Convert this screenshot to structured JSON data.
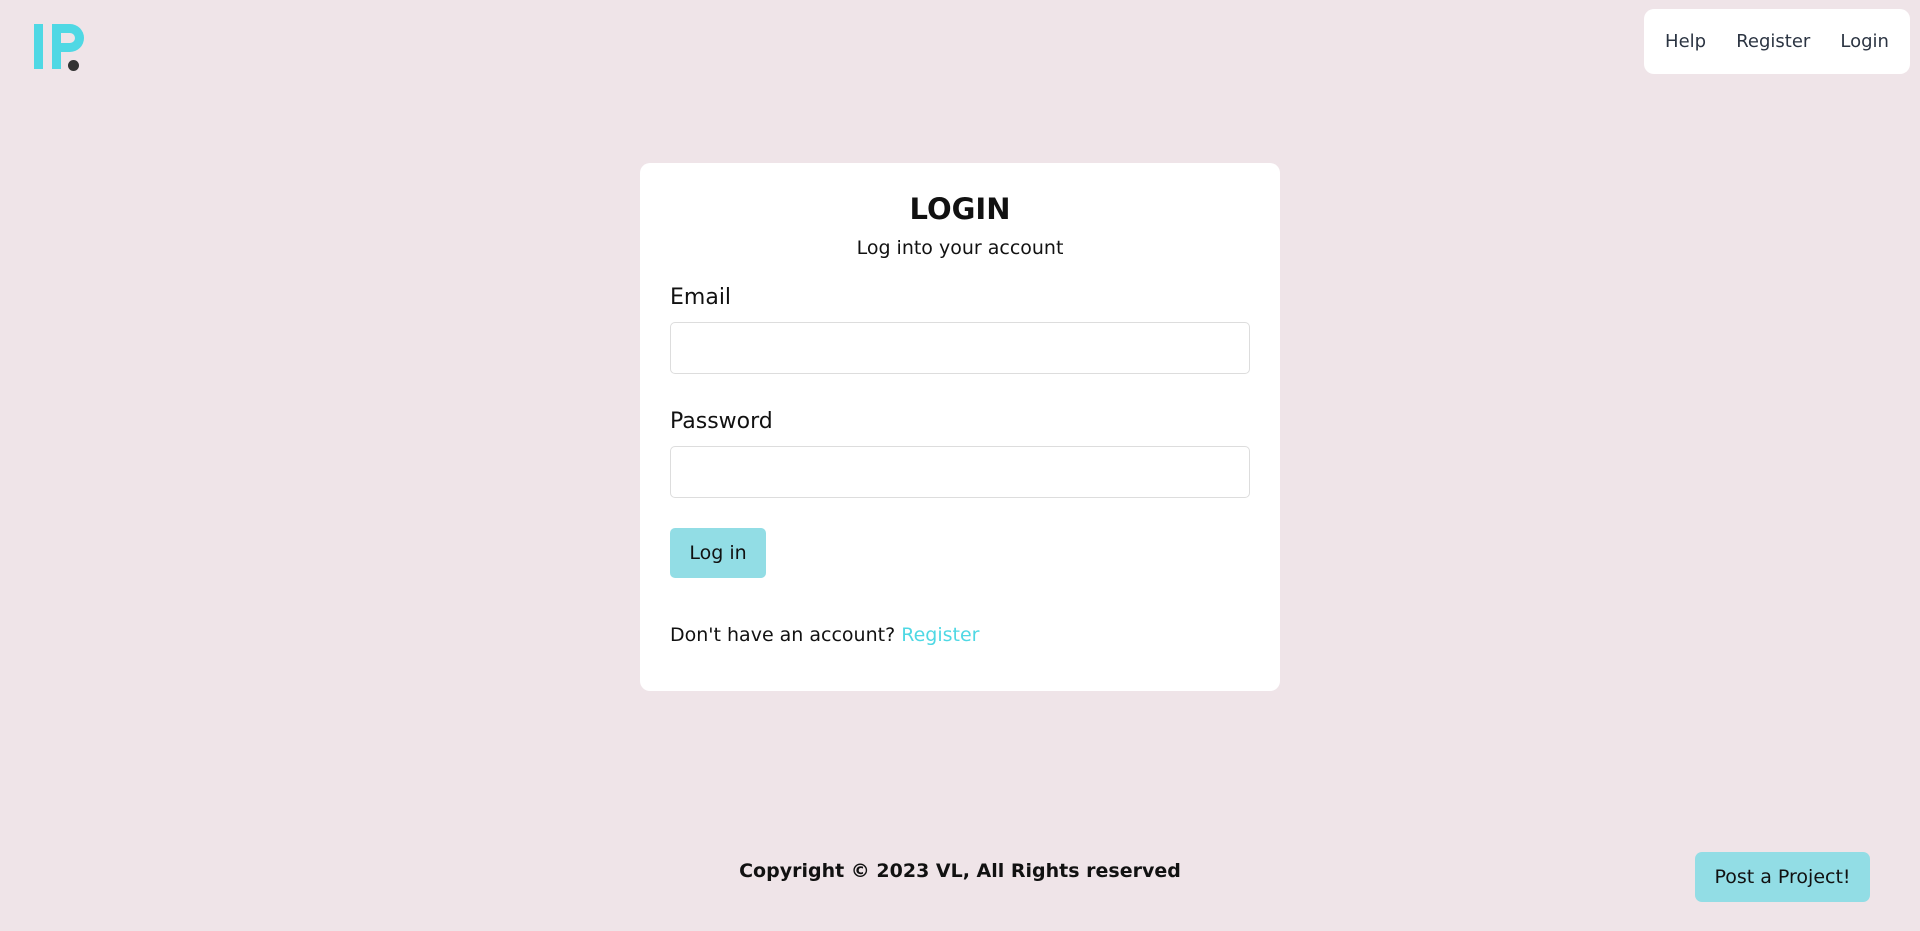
{
  "nav": {
    "help": "Help",
    "register": "Register",
    "login": "Login"
  },
  "login": {
    "title": "LOGIN",
    "subtitle": "Log into your account",
    "email_label": "Email",
    "email_value": "",
    "password_label": "Password",
    "password_value": "",
    "submit_label": "Log in",
    "no_account_text": "Don't have an account?",
    "register_link": "Register"
  },
  "footer": {
    "copyright": "Copyright © 2023 VL, All Rights reserved"
  },
  "post_project_label": "Post a Project!",
  "colors": {
    "background": "#efe4e8",
    "accent": "#4fd8e4",
    "button": "#92dde5"
  }
}
